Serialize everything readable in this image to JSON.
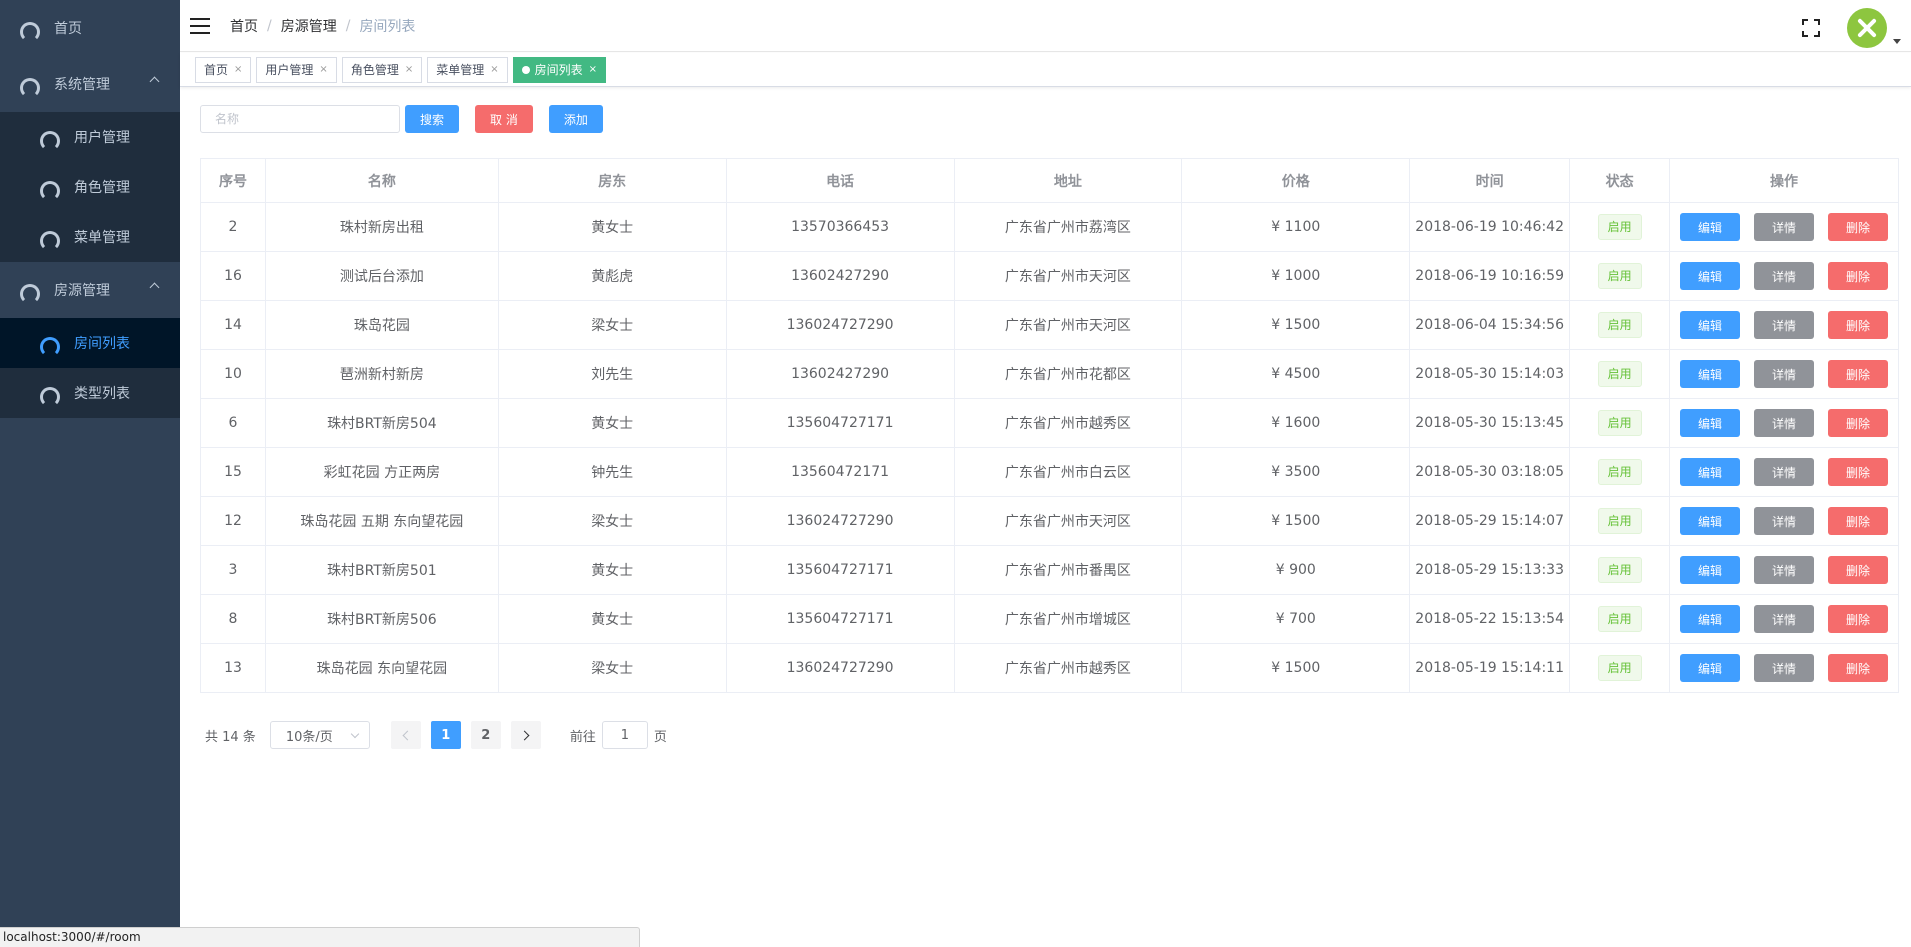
{
  "sidebar": {
    "items": [
      {
        "label": "首页"
      },
      {
        "label": "系统管理"
      },
      {
        "label": "用户管理"
      },
      {
        "label": "角色管理"
      },
      {
        "label": "菜单管理"
      },
      {
        "label": "房源管理"
      },
      {
        "label": "房间列表"
      },
      {
        "label": "类型列表"
      }
    ]
  },
  "header": {
    "breadcrumb": [
      "首页",
      "房源管理",
      "房间列表"
    ],
    "breadcrumb_sep": "/"
  },
  "tags": [
    {
      "label": "首页",
      "close": "×"
    },
    {
      "label": "用户管理",
      "close": "×"
    },
    {
      "label": "角色管理",
      "close": "×"
    },
    {
      "label": "菜单管理",
      "close": "×"
    },
    {
      "label": "房间列表",
      "close": "×"
    }
  ],
  "toolbar": {
    "search_placeholder": "名称",
    "search_label": "搜索",
    "cancel_label": "取 消",
    "add_label": "添加"
  },
  "table": {
    "headers": [
      "序号",
      "名称",
      "房东",
      "电话",
      "地址",
      "价格",
      "时间",
      "状态",
      "操作"
    ],
    "rows": [
      [
        "2",
        "珠村新房出租",
        "黄女士",
        "13570366453",
        "广东省广州市荔湾区",
        "¥ 1100",
        "2018-06-19 10:46:42",
        "启用"
      ],
      [
        "16",
        "测试后台添加",
        "黄彪虎",
        "13602427290",
        "广东省广州市天河区",
        "¥ 1000",
        "2018-06-19 10:16:59",
        "启用"
      ],
      [
        "14",
        "珠岛花园",
        "梁女士",
        "136024727290",
        "广东省广州市天河区",
        "¥ 1500",
        "2018-06-04 15:34:56",
        "启用"
      ],
      [
        "10",
        "琶洲新村新房",
        "刘先生",
        "13602427290",
        "广东省广州市花都区",
        "¥ 4500",
        "2018-05-30 15:14:03",
        "启用"
      ],
      [
        "6",
        "珠村BRT新房504",
        "黄女士",
        "135604727171",
        "广东省广州市越秀区",
        "¥ 1600",
        "2018-05-30 15:13:45",
        "启用"
      ],
      [
        "15",
        "彩虹花园 方正两房",
        "钟先生",
        "13560472171",
        "广东省广州市白云区",
        "¥ 3500",
        "2018-05-30 03:18:05",
        "启用"
      ],
      [
        "12",
        "珠岛花园 五期 东向望花园",
        "梁女士",
        "136024727290",
        "广东省广州市天河区",
        "¥ 1500",
        "2018-05-29 15:14:07",
        "启用"
      ],
      [
        "3",
        "珠村BRT新房501",
        "黄女士",
        "135604727171",
        "广东省广州市番禺区",
        "¥ 900",
        "2018-05-29 15:13:33",
        "启用"
      ],
      [
        "8",
        "珠村BRT新房506",
        "黄女士",
        "135604727171",
        "广东省广州市增城区",
        "¥ 700",
        "2018-05-22 15:13:54",
        "启用"
      ],
      [
        "13",
        "珠岛花园 东向望花园",
        "梁女士",
        "136024727290",
        "广东省广州市越秀区",
        "¥ 1500",
        "2018-05-19 15:14:11",
        "启用"
      ]
    ],
    "actions": {
      "edit": "编辑",
      "detail": "详情",
      "delete": "删除"
    }
  },
  "pagination": {
    "total": "共 14 条",
    "page_size": "10条/页",
    "pages": [
      "1",
      "2"
    ],
    "current_page": "1",
    "goto_label": "前往",
    "goto_value": "1",
    "page_suffix": "页"
  },
  "statusbar": {
    "url": "localhost:3000/#/room"
  },
  "colors": {
    "sidebar_bg": "#304156",
    "primary": "#409eff",
    "danger": "#f56c6c",
    "info": "#909399",
    "success": "#67c23a",
    "active_tag": "#42b983"
  }
}
